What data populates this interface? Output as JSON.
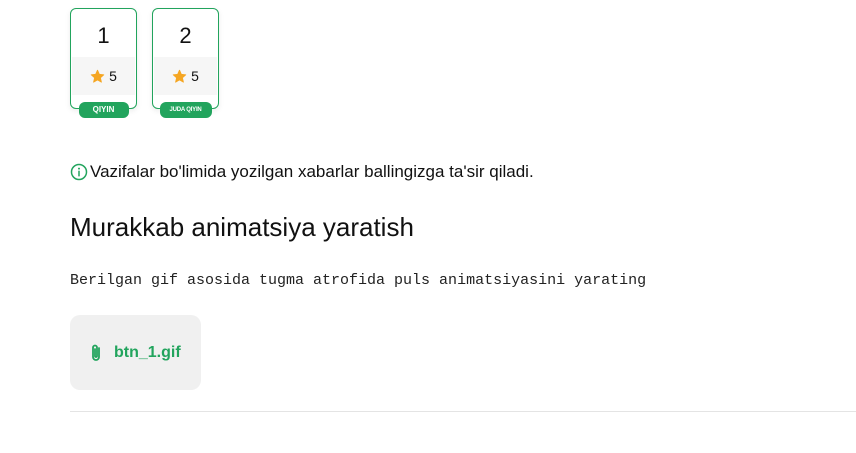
{
  "tasks": [
    {
      "number": "1",
      "score": "5",
      "difficulty": "QIYIN"
    },
    {
      "number": "2",
      "score": "5",
      "difficulty": "JUDA QIYIN"
    }
  ],
  "notice": {
    "icon": "info-icon",
    "text": "Vazifalar bo'limida yozilgan xabarlar ballingizga ta'sir qiladi."
  },
  "task": {
    "title": "Murakkab animatsiya yaratish",
    "description": "Berilgan gif asosida tugma atrofida puls animatsiyasini yarating"
  },
  "attachment": {
    "icon": "paperclip-icon",
    "filename": "btn_1.gif"
  },
  "colors": {
    "accent": "#22a45d",
    "star": "#f5a623",
    "attachment_bg": "#f0f0f0"
  }
}
